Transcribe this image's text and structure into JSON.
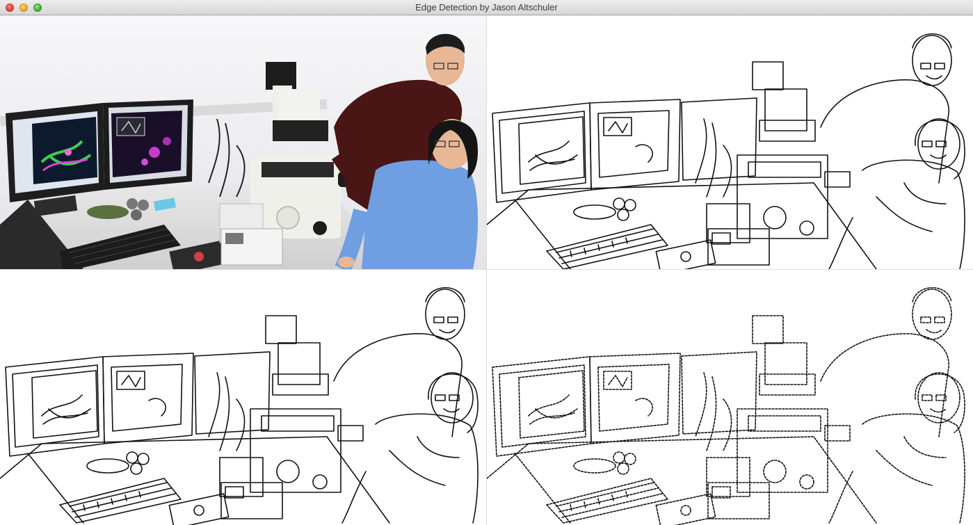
{
  "window": {
    "title": "Edge Detection by Jason Altschuler"
  },
  "colors": {
    "edge_stroke": "#111111",
    "screen_left_bg": "#0d1a2e",
    "screen_right_bg": "#1a0f28",
    "shirt_man": "#4a1515",
    "shirt_woman": "#6f9fe0"
  },
  "panels": [
    {
      "id": "original",
      "kind": "photo"
    },
    {
      "id": "edges-1",
      "kind": "edge-map"
    },
    {
      "id": "edges-2",
      "kind": "edge-map"
    },
    {
      "id": "edges-3",
      "kind": "edge-map"
    }
  ]
}
